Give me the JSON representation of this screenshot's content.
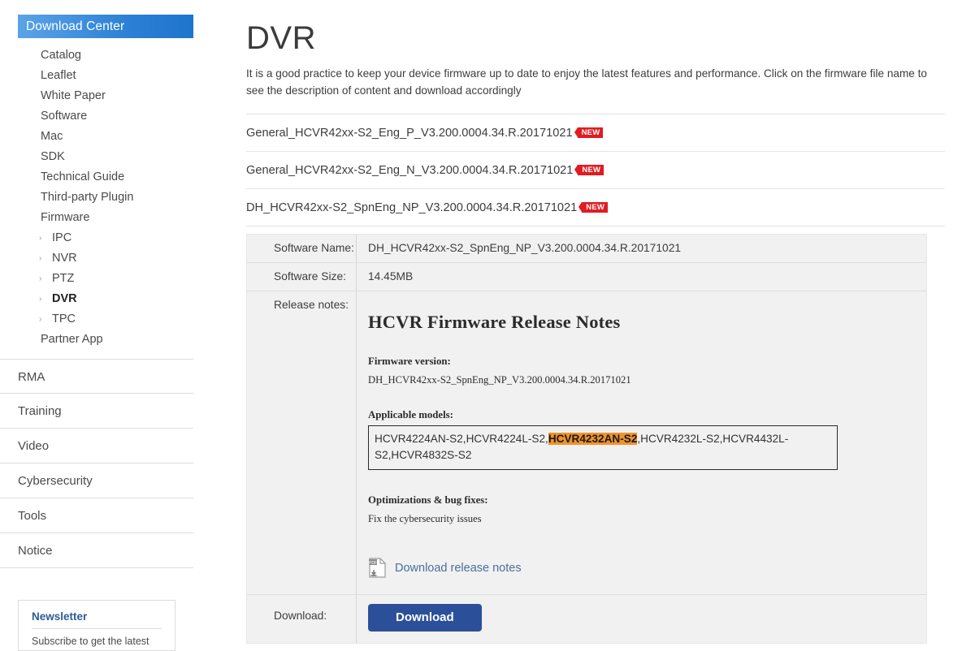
{
  "sidebar": {
    "header": "Download Center",
    "nav_items": [
      {
        "label": "Catalog",
        "sub": false
      },
      {
        "label": "Leaflet",
        "sub": false
      },
      {
        "label": "White Paper",
        "sub": false
      },
      {
        "label": "Software",
        "sub": false
      },
      {
        "label": "Mac",
        "sub": false
      },
      {
        "label": "SDK",
        "sub": false
      },
      {
        "label": "Technical Guide",
        "sub": false
      },
      {
        "label": "Third-party Plugin",
        "sub": false
      },
      {
        "label": "Firmware",
        "sub": false
      },
      {
        "label": "IPC",
        "sub": true,
        "active": false
      },
      {
        "label": "NVR",
        "sub": true,
        "active": false
      },
      {
        "label": "PTZ",
        "sub": true,
        "active": false
      },
      {
        "label": "DVR",
        "sub": true,
        "active": true
      },
      {
        "label": "TPC",
        "sub": true,
        "active": false
      },
      {
        "label": "Partner App",
        "sub": false
      }
    ],
    "major_items": [
      {
        "label": "RMA"
      },
      {
        "label": "Training"
      },
      {
        "label": "Video"
      },
      {
        "label": "Cybersecurity"
      },
      {
        "label": "Tools"
      },
      {
        "label": "Notice"
      }
    ],
    "newsletter": {
      "title": "Newsletter",
      "subtitle": "Subscribe to get the latest"
    }
  },
  "main": {
    "title": "DVR",
    "description": "It is a good practice to keep your device firmware up to date to enjoy the latest features and performance. Click on the firmware file name to see the description of content and download accordingly",
    "firmware_items": [
      {
        "name": "General_HCVR42xx-S2_Eng_P_V3.200.0004.34.R.20171021",
        "badge": "NEW"
      },
      {
        "name": "General_HCVR42xx-S2_Eng_N_V3.200.0004.34.R.20171021",
        "badge": "NEW"
      },
      {
        "name": "DH_HCVR42xx-S2_SpnEng_NP_V3.200.0004.34.R.20171021",
        "badge": "NEW"
      }
    ],
    "detail": {
      "software_name_label": "Software Name:",
      "software_name_value": "DH_HCVR42xx-S2_SpnEng_NP_V3.200.0004.34.R.20171021",
      "software_size_label": "Software Size:",
      "software_size_value": "14.45MB",
      "release_notes_label": "Release notes:",
      "download_label": "Download:",
      "download_button": "Download",
      "notes": {
        "heading": "HCVR Firmware Release Notes",
        "firmware_version_label": "Firmware version:",
        "firmware_version_value": "DH_HCVR42xx-S2_SpnEng_NP_V3.200.0004.34.R.20171021",
        "applicable_models_label": "Applicable models:",
        "models_before": "HCVR4224AN-S2,HCVR4224L-S2,",
        "models_highlight": "HCVR4232AN-S2",
        "models_after": ",HCVR4232L-S2,HCVR4432L-S2,HCVR4832S-S2",
        "optimizations_label": "Optimizations & bug fixes:",
        "optimizations_value": "Fix the cybersecurity issues",
        "download_release_notes": "Download release notes"
      }
    }
  },
  "colors": {
    "header_blue_light": "#5ba3e8",
    "header_blue_dark": "#1f74cc",
    "badge_red": "#e11b22",
    "highlight_orange": "#f0922b",
    "button_blue": "#2b5099",
    "link_blue": "#4a6f9c",
    "panel_bg": "#f1f1f1"
  }
}
